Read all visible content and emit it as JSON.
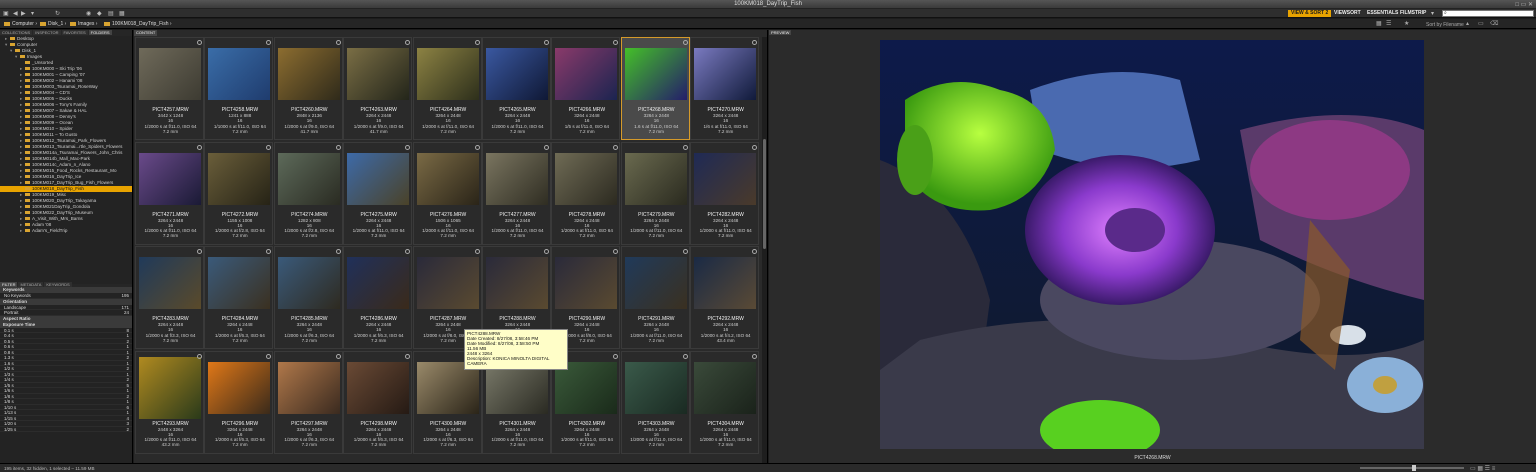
{
  "window": {
    "title": "100KM018_DayTrip_Fish"
  },
  "workspaces": [
    {
      "label": "VIEW & SORT 2",
      "active": true
    },
    {
      "label": "VIEWSORT",
      "active": false
    },
    {
      "label": "ESSENTIALS",
      "active": false
    },
    {
      "label": "FILMSTRIP",
      "active": false
    }
  ],
  "breadcrumb": [
    "Computer",
    "Disk_1",
    "Images",
    "100KM018_DayTrip_Fish"
  ],
  "sort_label": "Sort by Filename",
  "panels": {
    "left_tabs": [
      "COLLECTIONS",
      "INSPECTOR",
      "FAVORITES",
      "FOLDERS"
    ],
    "content_tab": "CONTENT",
    "preview_tab": "PREVIEW",
    "filter_tabs": [
      "FILTER",
      "METADATA",
      "KEYWORDS"
    ]
  },
  "tree": [
    {
      "label": "Desktop",
      "indent": 1,
      "arrow": "▸"
    },
    {
      "label": "Computer",
      "indent": 1,
      "arrow": "▾"
    },
    {
      "label": "Disk_1",
      "indent": 2,
      "arrow": "▾"
    },
    {
      "label": "Images",
      "indent": 3,
      "arrow": "▾"
    },
    {
      "label": "_Unsorted",
      "indent": 4,
      "arrow": ""
    },
    {
      "label": "100KM000 – Ski Trip '06",
      "indent": 4,
      "arrow": "▸"
    },
    {
      "label": "100KM001 – Camping '07",
      "indent": 4,
      "arrow": "▸"
    },
    {
      "label": "100KM002 – Hanami '08",
      "indent": 4,
      "arrow": "▸"
    },
    {
      "label": "100KM003_Tsuramai_RoseWay",
      "indent": 4,
      "arrow": "▸"
    },
    {
      "label": "100KM004 – CD'S",
      "indent": 4,
      "arrow": "▸"
    },
    {
      "label": "100KM005 – Ducks",
      "indent": 4,
      "arrow": "▸"
    },
    {
      "label": "100KM006 – Tony's Family",
      "indent": 4,
      "arrow": "▸"
    },
    {
      "label": "100KM007 – Sakae & HAL",
      "indent": 4,
      "arrow": "▸"
    },
    {
      "label": "100KM008 – Denny's",
      "indent": 4,
      "arrow": "▸"
    },
    {
      "label": "100KM009 – Ocean",
      "indent": 4,
      "arrow": "▸"
    },
    {
      "label": "100KM010 – Spider",
      "indent": 4,
      "arrow": "▸"
    },
    {
      "label": "100KM011 – To Gusto",
      "indent": 4,
      "arrow": "▸"
    },
    {
      "label": "100KM012_Tsuramai_Park_Flowers",
      "indent": 4,
      "arrow": "▸"
    },
    {
      "label": "100KM013_Tsuramai...rtle_Spiders_Flowers",
      "indent": 4,
      "arrow": "▸"
    },
    {
      "label": "100KM014a_Tsuramai_Flowers_John_Chris",
      "indent": 4,
      "arrow": "▸"
    },
    {
      "label": "100KM014b_Mall_Mac-Park",
      "indent": 4,
      "arrow": "▸"
    },
    {
      "label": "100KM014c_Adam_n_Alano",
      "indent": 4,
      "arrow": "▸"
    },
    {
      "label": "100KM015_Food_Rocks_Restaurant_Mo",
      "indent": 4,
      "arrow": "▸"
    },
    {
      "label": "100KM016_DayTrip_Ice",
      "indent": 4,
      "arrow": "▸"
    },
    {
      "label": "100KM017_DayTrip_Bug_Fish_Flowers",
      "indent": 4,
      "arrow": "▸"
    },
    {
      "label": "100KM018_DayTrip_Fish",
      "indent": 4,
      "arrow": "",
      "selected": true
    },
    {
      "label": "100KM019_Misc",
      "indent": 4,
      "arrow": "▸"
    },
    {
      "label": "100KM020_DayTrip_Takayama",
      "indent": 4,
      "arrow": "▸"
    },
    {
      "label": "100KM021DayTrip_Gondola",
      "indent": 4,
      "arrow": "▸"
    },
    {
      "label": "100KM022_DayTrip_Museum",
      "indent": 4,
      "arrow": "▸"
    },
    {
      "label": "A_Visit_With_Mrs_Barns",
      "indent": 4,
      "arrow": "▸"
    },
    {
      "label": "Adam '08",
      "indent": 4,
      "arrow": "▸"
    },
    {
      "label": "Adam's_FieldTrip",
      "indent": 4,
      "arrow": "▸"
    }
  ],
  "filter": [
    {
      "head": "Keywords"
    },
    {
      "label": "No Keywords",
      "count": "195"
    },
    {
      "head": "Orientation"
    },
    {
      "label": "Landscape",
      "count": "171"
    },
    {
      "label": "Portrait",
      "count": "24"
    },
    {
      "head": "Aspect Ratio"
    },
    {
      "head": "Exposure Time"
    },
    {
      "label": "0.1 s",
      "count": "8"
    },
    {
      "label": "0.4 s",
      "count": "1"
    },
    {
      "label": "0.5 s",
      "count": "2"
    },
    {
      "label": "0.6 s",
      "count": "1"
    },
    {
      "label": "0.8 s",
      "count": "1"
    },
    {
      "label": "1.3 s",
      "count": "2"
    },
    {
      "label": "1.6 s",
      "count": "1"
    },
    {
      "label": "1/2 s",
      "count": "2"
    },
    {
      "label": "1/3 s",
      "count": "1"
    },
    {
      "label": "1/4 s",
      "count": "2"
    },
    {
      "label": "1/5 s",
      "count": "5"
    },
    {
      "label": "1/6 s",
      "count": "1"
    },
    {
      "label": "1/8 s",
      "count": "2"
    },
    {
      "label": "1/8 s",
      "count": "1"
    },
    {
      "label": "1/10 s",
      "count": "6"
    },
    {
      "label": "1/13 s",
      "count": "1"
    },
    {
      "label": "1/15 s",
      "count": "4"
    },
    {
      "label": "1/20 s",
      "count": "3"
    },
    {
      "label": "1/25 s",
      "count": "2"
    }
  ],
  "thumbs": [
    {
      "name": "PICT4257.MRW",
      "l1": "3442 x 1248",
      "l2": "16",
      "l3": "1/2000 s at f/11.0, ISO 64",
      "l4": "7.2 mm",
      "c1": "#6f6a5a",
      "c2": "#3d3b32"
    },
    {
      "name": "PICT4258.MRW",
      "l1": "1241 x 888",
      "l2": "16",
      "l3": "1/1000 s at f/11.0, ISO 64",
      "l4": "7.2 mm",
      "c1": "#3a6da8",
      "c2": "#1f3c6e"
    },
    {
      "name": "PICT4260.MRW",
      "l1": "2848 x 2136",
      "l2": "16",
      "l3": "1/2000 s at f/9.0, ISO 64",
      "l4": "41.7 mm",
      "c1": "#8c6d30",
      "c2": "#2f2a1a"
    },
    {
      "name": "PICT4263.MRW",
      "l1": "3264 x 2448",
      "l2": "16",
      "l3": "1/2000 s at f/9.0, ISO 64",
      "l4": "41.7 mm",
      "c1": "#7a6e45",
      "c2": "#23251a"
    },
    {
      "name": "PICT4264.MRW",
      "l1": "3264 x 2448",
      "l2": "16",
      "l3": "1/2000 s at f/11.0, ISO 64",
      "l4": "7.2 mm",
      "c1": "#8c8243",
      "c2": "#2d2f1b"
    },
    {
      "name": "PICT4265.MRW",
      "l1": "3264 x 2448",
      "l2": "16",
      "l3": "1/2000 s at f/11.0, ISO 64",
      "l4": "7.2 mm",
      "c1": "#3a58a0",
      "c2": "#0f1835"
    },
    {
      "name": "PICT4266.MRW",
      "l1": "3264 x 2448",
      "l2": "16",
      "l3": "1/5 s at f/11.0, ISO 64",
      "l4": "7.2 mm",
      "c1": "#8a3a6a",
      "c2": "#1b2450"
    },
    {
      "name": "PICT4268.MRW",
      "l1": "3264 x 2448",
      "l2": "16",
      "l3": "1.6 s at f/11.0, ISO 64",
      "l4": "7.2 mm",
      "c1": "#44c028",
      "c2": "#241d6a",
      "selected": true
    },
    {
      "name": "PICT4270.MRW",
      "l1": "3264 x 2448",
      "l2": "16",
      "l3": "1/6 s at f/11.0, ISO 64",
      "l4": "7.2 mm",
      "c1": "#7a7ac0",
      "c2": "#101a3a"
    },
    {
      "name": "PICT4271.MRW",
      "l1": "3264 x 2448",
      "l2": "16",
      "l3": "1/2000 s at f/11.0, ISO 64",
      "l4": "7.2 mm",
      "c1": "#6a4a8a",
      "c2": "#1a1a35"
    },
    {
      "name": "PICT4272.MRW",
      "l1": "1155 x 1008",
      "l2": "16",
      "l3": "1/2000 s at f/2.8, ISO 64",
      "l4": "7.2 mm",
      "c1": "#6a5e3a",
      "c2": "#262316"
    },
    {
      "name": "PICT4274.MRW",
      "l1": "1282 x 808",
      "l2": "16",
      "l3": "1/2000 s at f/2.8, ISO 64",
      "l4": "7.2 mm",
      "c1": "#5d6a5a",
      "c2": "#2a2b22"
    },
    {
      "name": "PICT4275.MRW",
      "l1": "3264 x 2448",
      "l2": "16",
      "l3": "1/2000 s at f/11.0, ISO 64",
      "l4": "7.2 mm",
      "c1": "#3d6aa8",
      "c2": "#4a4228"
    },
    {
      "name": "PICT4276.MRW",
      "l1": "1506 x 1065",
      "l2": "16",
      "l3": "1/2000 s at f/11.0, ISO 64",
      "l4": "7.2 mm",
      "c1": "#7a6a45",
      "c2": "#2a2418"
    },
    {
      "name": "PICT4277.MRW",
      "l1": "3264 x 2448",
      "l2": "16",
      "l3": "1/2000 s at f/11.0, ISO 64",
      "l4": "7.2 mm",
      "c1": "#7a7560",
      "c2": "#2f2d22"
    },
    {
      "name": "PICT4278.MRW",
      "l1": "3264 x 2448",
      "l2": "16",
      "l3": "1/2000 s at f/11.0, ISO 64",
      "l4": "7.2 mm",
      "c1": "#6f6b55",
      "c2": "#2c2a20"
    },
    {
      "name": "PICT4279.MRW",
      "l1": "3264 x 2448",
      "l2": "16",
      "l3": "1/2000 s at f/11.0, ISO 64",
      "l4": "7.2 mm",
      "c1": "#6a6a4f",
      "c2": "#2a2a1f"
    },
    {
      "name": "PICT4282.MRW",
      "l1": "3264 x 2448",
      "l2": "16",
      "l3": "1/2000 s at f/11.0, ISO 64",
      "l4": "7.2 mm",
      "c1": "#1f2a55",
      "c2": "#4a3a2a"
    },
    {
      "name": "PICT4283.MRW",
      "l1": "3264 x 2448",
      "l2": "16",
      "l3": "1/2000 s at f/3.3, ISO 64",
      "l4": "7.2 mm",
      "c1": "#203a5a",
      "c2": "#5a4a2a"
    },
    {
      "name": "PICT4284.MRW",
      "l1": "3264 x 2448",
      "l2": "16",
      "l3": "1/2000 s at f/6.3, ISO 64",
      "l4": "7.2 mm",
      "c1": "#3a5a7a",
      "c2": "#3a3020"
    },
    {
      "name": "PICT4285.MRW",
      "l1": "3264 x 2448",
      "l2": "16",
      "l3": "1/2000 s at f/6.3, ISO 64",
      "l4": "7.2 mm",
      "c1": "#3a5a7a",
      "c2": "#2e2a20"
    },
    {
      "name": "PICT4286.MRW",
      "l1": "3264 x 2448",
      "l2": "16",
      "l3": "1/2000 s at f/6.3, ISO 64",
      "l4": "7.2 mm",
      "c1": "#20305a",
      "c2": "#3a2a1a"
    },
    {
      "name": "PICT4287.MRW",
      "l1": "3264 x 2448",
      "l2": "16",
      "l3": "1/2000 s at f/8.0, ISO 64",
      "l4": "7.2 mm",
      "c1": "#2a2a3a",
      "c2": "#5a4a30"
    },
    {
      "name": "PICT4288.MRW",
      "l1": "3264 x 2448",
      "l2": "16",
      "l3": "1/2000 s at f/8.0, ISO 64",
      "l4": "7.2 mm",
      "c1": "#2a2a3a",
      "c2": "#5a4a30"
    },
    {
      "name": "PICT4290.MRW",
      "l1": "3264 x 2448",
      "l2": "16",
      "l3": "1/2000 s at f/8.0, ISO 64",
      "l4": "7.2 mm",
      "c1": "#2a2a3a",
      "c2": "#5a4a30"
    },
    {
      "name": "PICT4291.MRW",
      "l1": "3264 x 2448",
      "l2": "16",
      "l3": "1/2000 s at f/11.0, ISO 64",
      "l4": "7.2 mm",
      "c1": "#203a5a",
      "c2": "#3a3020"
    },
    {
      "name": "PICT4292.MRW",
      "l1": "3264 x 2448",
      "l2": "16",
      "l3": "1/2000 s at f/4.2, ISO 64",
      "l4": "43.4 mm",
      "c1": "#1a2a45",
      "c2": "#5a4a35"
    },
    {
      "name": "PICT4293.MRW",
      "l1": "2448 x 3264",
      "l2": "16",
      "l3": "1/2000 s at f/11.0, ISO 64",
      "l4": "43.2 mm",
      "c1": "#b08a20",
      "c2": "#2a3a1a"
    },
    {
      "name": "PICT4296.MRW",
      "l1": "3264 x 2448",
      "l2": "16",
      "l3": "1/2000 s at f/6.3, ISO 64",
      "l4": "7.2 mm",
      "c1": "#e07818",
      "c2": "#3a2a1a"
    },
    {
      "name": "PICT4297.MRW",
      "l1": "3264 x 2448",
      "l2": "16",
      "l3": "1/2000 s at f/6.3, ISO 64",
      "l4": "7.2 mm",
      "c1": "#b0784a",
      "c2": "#3a2a1f"
    },
    {
      "name": "PICT4298.MRW",
      "l1": "3264 x 2448",
      "l2": "16",
      "l3": "1/2000 s at f/6.3, ISO 64",
      "l4": "7.2 mm",
      "c1": "#6a4a35",
      "c2": "#251a14"
    },
    {
      "name": "PICT4300.MRW",
      "l1": "3264 x 2448",
      "l2": "16",
      "l3": "1/2000 s at f/6.3, ISO 64",
      "l4": "7.2 mm",
      "c1": "#9a8a6a",
      "c2": "#2a2418"
    },
    {
      "name": "PICT4301.MRW",
      "l1": "3264 x 2448",
      "l2": "16",
      "l3": "1/2000 s at f/11.0, ISO 64",
      "l4": "7.2 mm",
      "c1": "#7a7a6a",
      "c2": "#2a2a22"
    },
    {
      "name": "PICT4302.MRW",
      "l1": "3264 x 2448",
      "l2": "16",
      "l3": "1/2000 s at f/11.0, ISO 64",
      "l4": "7.2 mm",
      "c1": "#3a5a3a",
      "c2": "#1a2a1a"
    },
    {
      "name": "PICT4303.MRW",
      "l1": "3264 x 2448",
      "l2": "16",
      "l3": "1/2000 s at f/11.0, ISO 64",
      "l4": "7.2 mm",
      "c1": "#3a5a4a",
      "c2": "#1a2a22"
    },
    {
      "name": "PICT4304.MRW",
      "l1": "3264 x 2448",
      "l2": "16",
      "l3": "1/2000 s at f/11.0, ISO 64",
      "l4": "7.2 mm",
      "c1": "#3a4a3a",
      "c2": "#1a221a"
    }
  ],
  "tooltip": [
    "PICT4288.MRW",
    "Date Created: 8/27/08, 3:58:46 PM",
    "Date Modified: 8/27/08, 3:58:50 PM",
    "11.56 MB",
    "2448 x 3264",
    "Description: KONICA MINOLTA DIGITAL",
    "CAMERA"
  ],
  "preview": {
    "caption": "PICT4268.MRW"
  },
  "status": "195 items, 32 hidden, 1 selected – 11.59 MB"
}
